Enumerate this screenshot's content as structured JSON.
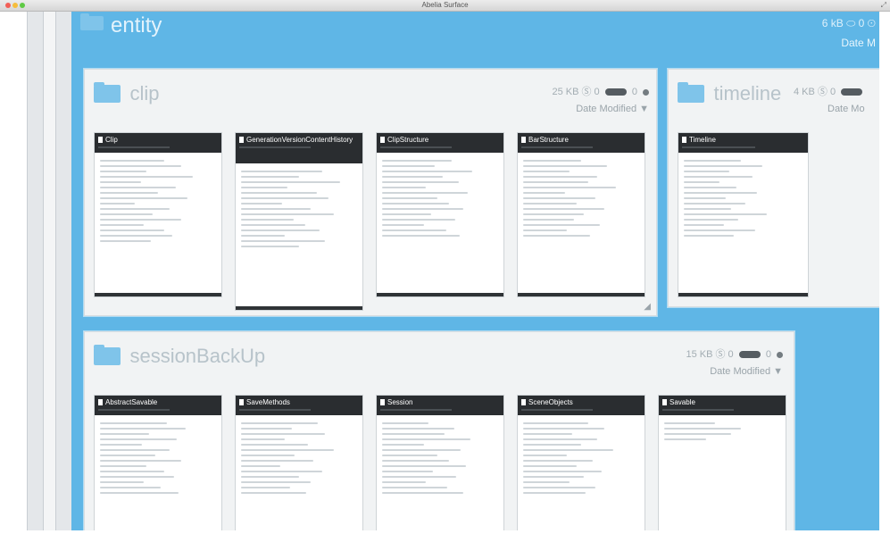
{
  "window": {
    "title": "Abelia Surface"
  },
  "entity": {
    "title": "entity",
    "stats": "6 kB ⬭ 0 ⊙",
    "sort": "Date M"
  },
  "groups": [
    {
      "name": "clip",
      "size": "25 KB",
      "tag": "Ⓢ 0",
      "count": "0",
      "sort": "Date Modified ▼",
      "cards": [
        {
          "title": "Clip"
        },
        {
          "title": "GenerationVersionContentHistory"
        },
        {
          "title": "ClipStructure"
        },
        {
          "title": "BarStructure"
        }
      ]
    },
    {
      "name": "timeline",
      "size": "4 KB",
      "tag": "Ⓢ 0",
      "count": "",
      "sort": "Date Mo",
      "cards": [
        {
          "title": "Timeline"
        }
      ]
    },
    {
      "name": "sessionBackUp",
      "size": "15 KB",
      "tag": "Ⓢ 0",
      "count": "0",
      "sort": "Date Modified ▼",
      "cards": [
        {
          "title": "AbstractSavable"
        },
        {
          "title": "SaveMethods"
        },
        {
          "title": "Session"
        },
        {
          "title": "SceneObjects"
        },
        {
          "title": "Savable"
        }
      ]
    }
  ],
  "colors": {
    "canvas": "#5fb6e6",
    "card_header": "#2a2d30",
    "panel": "#f1f3f4"
  },
  "icons": {
    "folder": "folder-icon",
    "document": "document-icon",
    "toggle": "toggle-pill-icon",
    "sort_arrow": "sort-down-icon"
  }
}
